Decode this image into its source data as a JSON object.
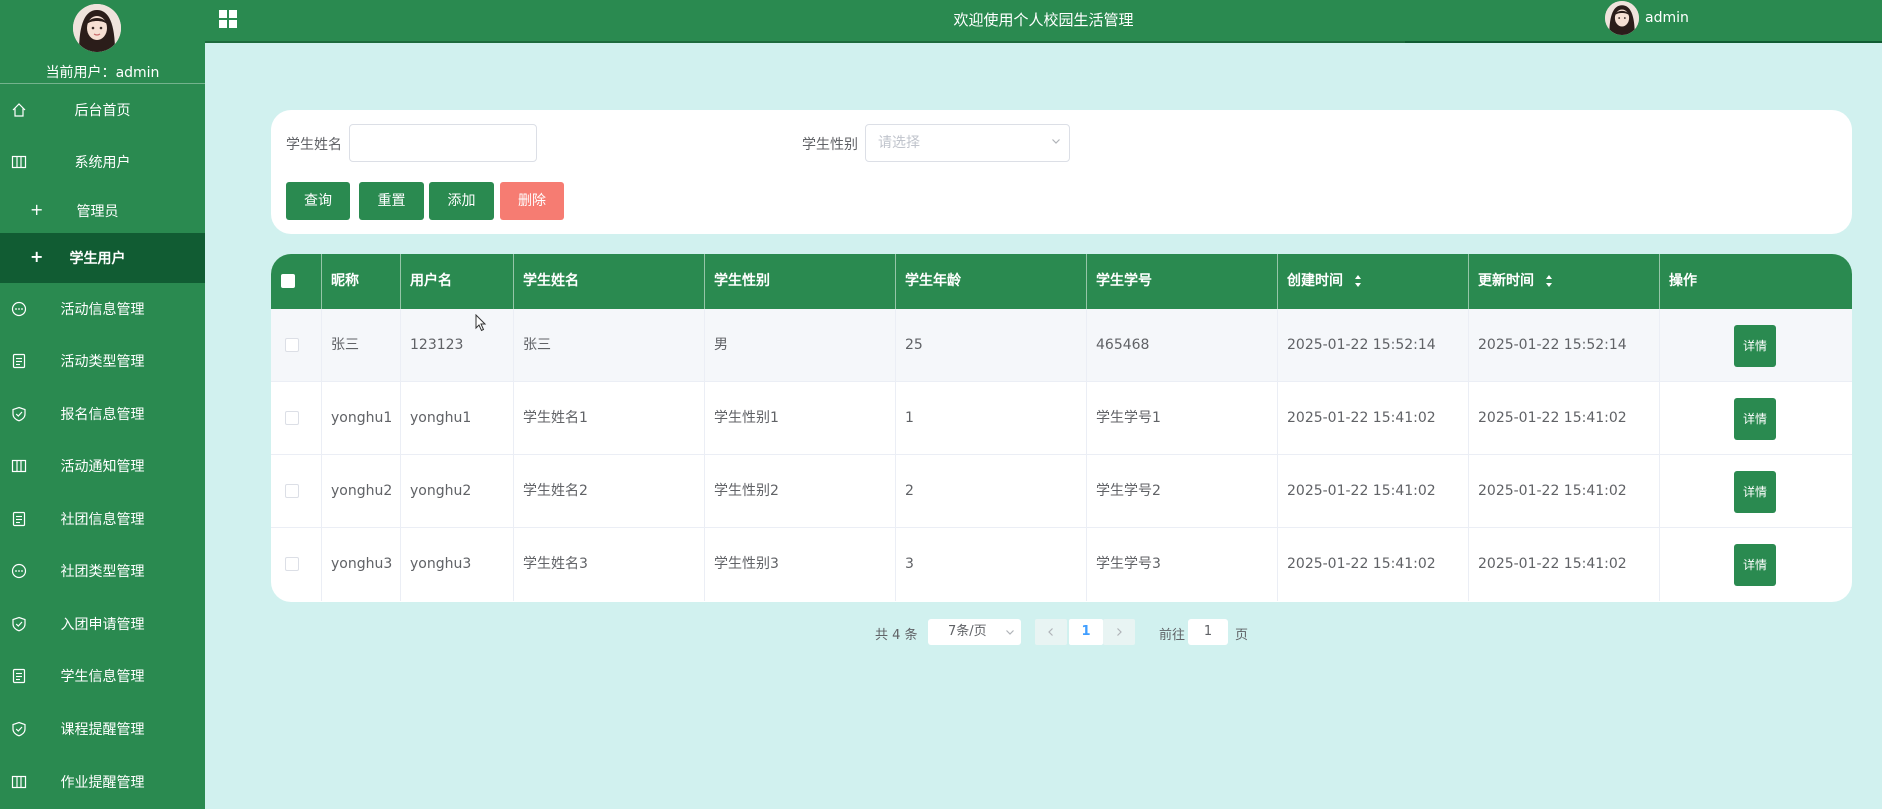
{
  "sidebar": {
    "current_user_label": "当前用户：",
    "current_user": "admin",
    "items": [
      {
        "label": "后台首页",
        "icon": "home-icon"
      },
      {
        "label": "系统用户",
        "icon": "columns-icon"
      },
      {
        "label": "管理员",
        "icon": "plus-icon"
      },
      {
        "label": "学生用户",
        "icon": "plus-icon"
      },
      {
        "label": "活动信息管理",
        "icon": "chat-icon"
      },
      {
        "label": "活动类型管理",
        "icon": "document-icon"
      },
      {
        "label": "报名信息管理",
        "icon": "shield-check-icon"
      },
      {
        "label": "活动通知管理",
        "icon": "columns-icon"
      },
      {
        "label": "社团信息管理",
        "icon": "document-icon"
      },
      {
        "label": "社团类型管理",
        "icon": "chat-icon"
      },
      {
        "label": "入团申请管理",
        "icon": "shield-check-icon"
      },
      {
        "label": "学生信息管理",
        "icon": "document-icon"
      },
      {
        "label": "课程提醒管理",
        "icon": "shield-check-icon"
      },
      {
        "label": "作业提醒管理",
        "icon": "columns-icon"
      }
    ]
  },
  "header": {
    "title": "欢迎使用个人校园生活管理",
    "user": "admin"
  },
  "search": {
    "name_label": "学生姓名",
    "name_value": "",
    "gender_label": "学生性别",
    "gender_placeholder": "请选择",
    "query": "查询",
    "reset": "重置",
    "add": "添加",
    "delete": "删除"
  },
  "table": {
    "columns": [
      "昵称",
      "用户名",
      "学生姓名",
      "学生性别",
      "学生年龄",
      "学生学号",
      "创建时间",
      "更新时间",
      "操作"
    ],
    "detail_label": "详情",
    "rows": [
      {
        "nickname": "张三",
        "username": "123123",
        "name": "张三",
        "gender": "男",
        "age": "25",
        "student_no": "465468",
        "created": "2025-01-22 15:52:14",
        "updated": "2025-01-22 15:52:14"
      },
      {
        "nickname": "yonghu1",
        "username": "yonghu1",
        "name": "学生姓名1",
        "gender": "学生性别1",
        "age": "1",
        "student_no": "学生学号1",
        "created": "2025-01-22 15:41:02",
        "updated": "2025-01-22 15:41:02"
      },
      {
        "nickname": "yonghu2",
        "username": "yonghu2",
        "name": "学生姓名2",
        "gender": "学生性别2",
        "age": "2",
        "student_no": "学生学号2",
        "created": "2025-01-22 15:41:02",
        "updated": "2025-01-22 15:41:02"
      },
      {
        "nickname": "yonghu3",
        "username": "yonghu3",
        "name": "学生姓名3",
        "gender": "学生性别3",
        "age": "3",
        "student_no": "学生学号3",
        "created": "2025-01-22 15:41:02",
        "updated": "2025-01-22 15:41:02"
      }
    ]
  },
  "pagination": {
    "total": "共 4 条",
    "page_size": "7条/页",
    "current_page": "1",
    "goto_label": "前往",
    "goto_value": "1",
    "page_unit": "页"
  },
  "colors": {
    "primary": "#2a8a50",
    "primary_dark": "#115c33",
    "background": "#d1f1ef",
    "danger": "#f67c72"
  }
}
